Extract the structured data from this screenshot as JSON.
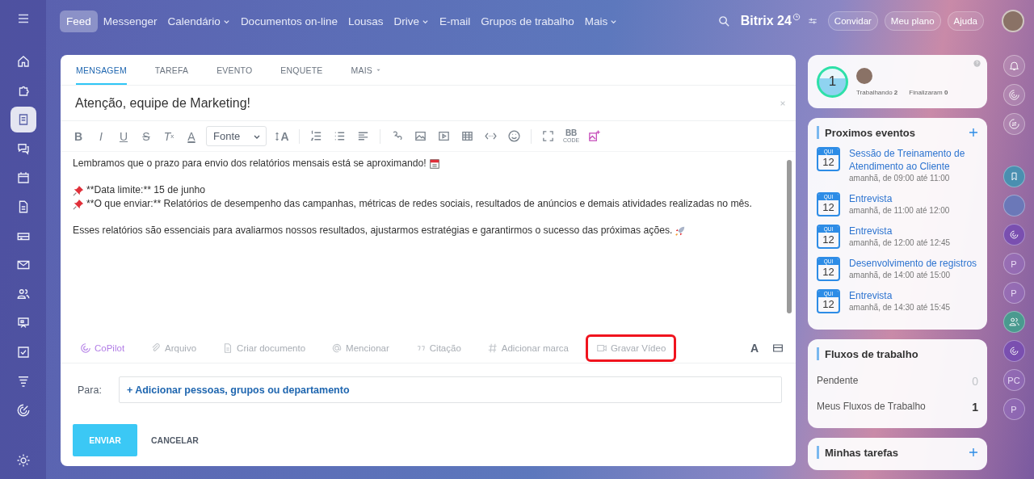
{
  "top_nav": [
    {
      "label": "Feed",
      "selected": true,
      "dropdown": false
    },
    {
      "label": "Messenger",
      "selected": false,
      "dropdown": false
    },
    {
      "label": "Calendário",
      "selected": false,
      "dropdown": true
    },
    {
      "label": "Documentos on-line",
      "selected": false,
      "dropdown": false
    },
    {
      "label": "Lousas",
      "selected": false,
      "dropdown": false
    },
    {
      "label": "Drive",
      "selected": false,
      "dropdown": true
    },
    {
      "label": "E-mail",
      "selected": false,
      "dropdown": false
    },
    {
      "label": "Grupos de trabalho",
      "selected": false,
      "dropdown": false
    },
    {
      "label": "Mais",
      "selected": false,
      "dropdown": true
    }
  ],
  "logo": {
    "name": "Bitrix",
    "number": "24"
  },
  "header_buttons": [
    "Convidar",
    "Meu plano",
    "Ajuda"
  ],
  "sidebar_items": [
    {
      "kind": "home",
      "selected": false
    },
    {
      "kind": "puzzle",
      "selected": false
    },
    {
      "kind": "feed",
      "selected": true
    },
    {
      "kind": "chat",
      "selected": false
    },
    {
      "kind": "calendar",
      "selected": false
    },
    {
      "kind": "document",
      "selected": false
    },
    {
      "kind": "drive",
      "selected": false
    },
    {
      "kind": "mail",
      "selected": false
    },
    {
      "kind": "people",
      "selected": false
    },
    {
      "kind": "board",
      "selected": false
    },
    {
      "kind": "task",
      "selected": false
    },
    {
      "kind": "filter",
      "selected": false
    },
    {
      "kind": "target",
      "selected": false
    }
  ],
  "composer": {
    "tabs": [
      {
        "label": "MENSAGEM",
        "selected": true,
        "dropdown": false
      },
      {
        "label": "TAREFA",
        "selected": false,
        "dropdown": false
      },
      {
        "label": "EVENTO",
        "selected": false,
        "dropdown": false
      },
      {
        "label": "ENQUETE",
        "selected": false,
        "dropdown": false
      },
      {
        "label": "MAIS",
        "selected": false,
        "dropdown": true
      }
    ],
    "title": "Atenção, equipe de Marketing!",
    "format_buttons": [
      {
        "kind": "bold",
        "text": "B"
      },
      {
        "kind": "italic",
        "text": "I"
      },
      {
        "kind": "underline",
        "text": "U"
      },
      {
        "kind": "strike",
        "text": "S"
      },
      {
        "kind": "clear",
        "text": "T",
        "sub": "x"
      },
      {
        "kind": "color",
        "text": "A"
      }
    ],
    "font_select": "Fonte",
    "size_button": "A",
    "bbcode": {
      "top": "BB",
      "bottom": "CODE"
    },
    "body": [
      {
        "lines": [
          {
            "kind": "calendar",
            "text": "Lembramos que o prazo para envio dos relatórios mensais está se aproximando!"
          }
        ]
      },
      {
        "lines": [
          {
            "kind": "pin",
            "text": "**Data limite:** 15 de junho"
          },
          {
            "kind": "pin",
            "text": "**O que enviar:** Relatórios de desempenho das campanhas, métricas de redes sociais, resultados de anúncios e demais atividades realizadas no mês."
          }
        ]
      },
      {
        "lines": [
          {
            "kind": "rocket",
            "text": "Esses relatórios são essenciais para avaliarmos nossos resultados, ajustarmos estratégias e garantirmos o sucesso das próximas ações."
          }
        ]
      }
    ],
    "actions": [
      {
        "kind": "copilot",
        "label": "CoPilot",
        "highlighted": false
      },
      {
        "kind": "file",
        "label": "Arquivo",
        "highlighted": false
      },
      {
        "kind": "document",
        "label": "Criar documento",
        "highlighted": false
      },
      {
        "kind": "mention",
        "label": "Mencionar",
        "highlighted": false
      },
      {
        "kind": "quote",
        "label": "Citação",
        "highlighted": false
      },
      {
        "kind": "tag",
        "label": "Adicionar marca",
        "highlighted": false
      },
      {
        "kind": "video",
        "label": "Gravar Vídeo",
        "highlighted": true
      }
    ],
    "text_style_button": "A",
    "recipients": {
      "label": "Para:",
      "add_link": "+ Adicionar pessoas, grupos ou departamento"
    },
    "send_button": "ENVIAR",
    "cancel_button": "CANCELAR"
  },
  "status_card": {
    "counter": "1",
    "working_label": "Trabalhando",
    "working_count": "2",
    "finished_label": "Finalizaram",
    "finished_count": "0"
  },
  "events_card": {
    "title": "Proximos eventos",
    "events": [
      {
        "weekday": "QUI",
        "day": "12",
        "title": "Sessão de Treinamento de Atendimento ao Cliente",
        "time": "amanhã, de 09:00 até 11:00"
      },
      {
        "weekday": "QUI",
        "day": "12",
        "title": "Entrevista",
        "time": "amanhã, de 11:00 até 12:00"
      },
      {
        "weekday": "QUI",
        "day": "12",
        "title": "Entrevista",
        "time": "amanhã, de 12:00 até 12:45"
      },
      {
        "weekday": "QUI",
        "day": "12",
        "title": "Desenvolvimento de registros",
        "time": "amanhã, de 14:00 até 15:00"
      },
      {
        "weekday": "QUI",
        "day": "12",
        "title": "Entrevista",
        "time": "amanhã, de 14:30 até 15:45"
      }
    ]
  },
  "workflows_card": {
    "title": "Fluxos de trabalho",
    "rows": [
      {
        "label": "Pendente",
        "count": "0",
        "dimmed": true
      },
      {
        "label": "Meus Fluxos de Trabalho",
        "count": "1",
        "dimmed": false
      }
    ]
  },
  "tasks_card": {
    "title": "Minhas tarefas"
  },
  "right_rail": [
    {
      "kind": "bell"
    },
    {
      "kind": "spiral"
    },
    {
      "kind": "chat"
    },
    {
      "kind": "spacer"
    },
    {
      "kind": "bookmark"
    },
    {
      "kind": "photo"
    },
    {
      "kind": "copilot"
    },
    {
      "kind": "initials",
      "text": "P"
    },
    {
      "kind": "initials",
      "text": "P"
    },
    {
      "kind": "group"
    },
    {
      "kind": "copilot"
    },
    {
      "kind": "initials",
      "text": "PC"
    },
    {
      "kind": "initials",
      "text": "P"
    }
  ]
}
